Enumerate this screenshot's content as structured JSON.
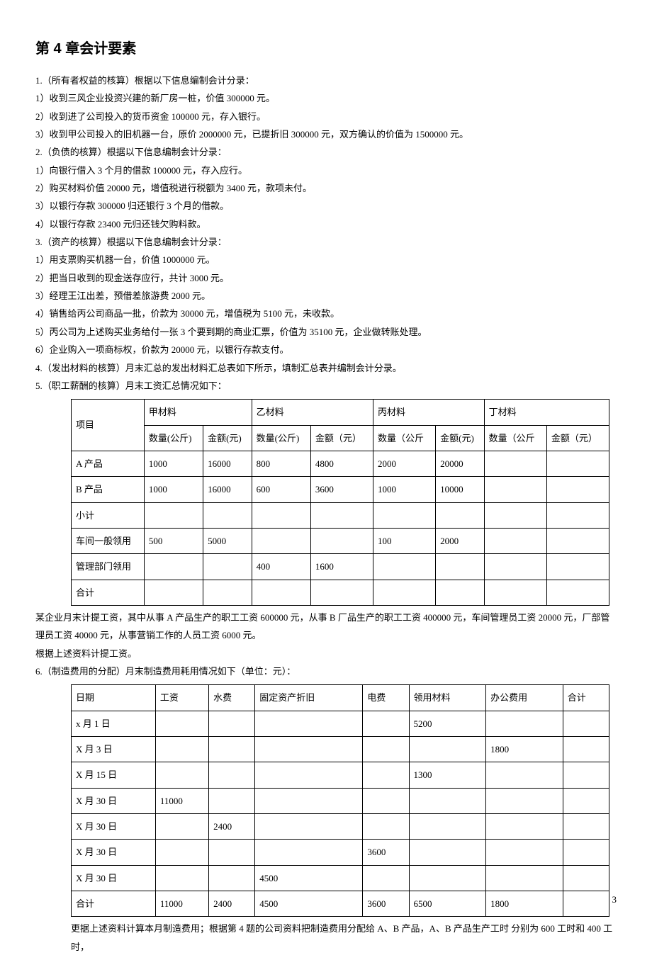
{
  "heading": "第 4 章会计要素",
  "paras": [
    "1.（所有者权益的核算）根据以下信息编制会计分录：",
    "1）收到三风企业投资兴建的新厂房一桩，价值 300000 元。",
    "2）收到进了公司投入的货币资金 100000 元，存入银行。",
    "3）收到甲公司投入的旧机器一台，原价 2000000 元，已提折旧 300000 元，双方确认的价值为 1500000 元。",
    "2.（负债的核算）根据以下信息编制会计分录：",
    "1）向银行借入 3 个月的借款 100000 元，存入应行。",
    "2）购买材料价值 20000 元，增值税进行税额为 3400 元，款项未付。",
    "3）以银行存款 300000 归还银行 3 个月的借款。",
    "4）以银行存款 23400 元归还钱欠购料款。",
    "3.（资产的核算）根据以下信息编制会计分录：",
    "1）用支票购买机器一台，价值 1000000 元。",
    "2）把当日收到的现金送存应行，共计 3000 元。",
    "3）经理王江出差，预借差旅游费 2000 元。",
    "4）销售给丙公司商品一批，价款为 30000 元，增值税为 5100 元，未收款。",
    "5）丙公司为上述购买业务给付一张 3 个要到期的商业汇票，价值为 35100 元，企业做转账处理。",
    "6）企业购入一项商标权，价款为 20000 元，以银行存款支付。",
    "4.（发出材料的核算）月末汇总的发出材料汇总表如下所示，填制汇总表并编制会计分录。",
    "5.（职工薪酬的核算）月末工资汇总情况如下："
  ],
  "table1": {
    "col_item": "项目",
    "groups": [
      "甲材料",
      "乙材料",
      "丙材料",
      "丁材料"
    ],
    "sub_qty": "数量(公斤)",
    "sub_qty_wide": "数量（公斤",
    "sub_amt": "金额(元)",
    "sub_amt_wide": "金额（元）",
    "rows": [
      {
        "label": "A 产品",
        "c": [
          "1000",
          "16000",
          "800",
          "4800",
          "2000",
          "20000",
          "",
          ""
        ]
      },
      {
        "label": "B 产品",
        "c": [
          "1000",
          "16000",
          "600",
          "3600",
          "1000",
          "10000",
          "",
          ""
        ]
      },
      {
        "label": "小计",
        "c": [
          "",
          "",
          "",
          "",
          "",
          "",
          "",
          ""
        ]
      },
      {
        "label": "车间一般领用",
        "c": [
          "500",
          "5000",
          "",
          "",
          "100",
          "2000",
          "",
          ""
        ]
      },
      {
        "label": "管理部门领用",
        "c": [
          "",
          "",
          "400",
          "1600",
          "",
          "",
          "",
          ""
        ]
      },
      {
        "label": "合计",
        "c": [
          "",
          "",
          "",
          "",
          "",
          "",
          "",
          ""
        ]
      }
    ]
  },
  "mid_paras": [
    "某企业月末计提工资，其中从事 A 产品生产的职工工资 600000 元，从事 B 厂品生产的职工工资 400000 元，车间管理员工资 20000 元，厂部管理员工资 40000 元，从事营销工作的人员工资 6000 元。",
    "根据上述资料计提工资。",
    "6.（制造费用的分配）月末制造费用耗用情况如下（单位：元）："
  ],
  "table2": {
    "headers": [
      "日期",
      "工资",
      "水费",
      "固定资产折旧",
      "电费",
      "领用材料",
      "办公费用",
      "合计"
    ],
    "rows": [
      {
        "c": [
          "x 月 1 日",
          "",
          "",
          "",
          "",
          "5200",
          "",
          ""
        ]
      },
      {
        "c": [
          "X 月 3 日",
          "",
          "",
          "",
          "",
          "",
          "1800",
          ""
        ]
      },
      {
        "c": [
          "X 月 15 日",
          "",
          "",
          "",
          "",
          "1300",
          "",
          ""
        ]
      },
      {
        "c": [
          "X 月 30 日",
          "11000",
          "",
          "",
          "",
          "",
          "",
          ""
        ]
      },
      {
        "c": [
          "X 月 30 日",
          "",
          "2400",
          "",
          "",
          "",
          "",
          ""
        ]
      },
      {
        "c": [
          "X 月 30 日",
          "",
          "",
          "",
          "3600",
          "",
          "",
          ""
        ]
      },
      {
        "c": [
          "X 月 30 日",
          "",
          "",
          "4500",
          "",
          "",
          "",
          ""
        ]
      },
      {
        "c": [
          "合计",
          "11000",
          "2400",
          "4500",
          "3600",
          "6500",
          "1800",
          ""
        ]
      }
    ]
  },
  "tail_para": "更据上述资料计算本月制造费用；根据第 4 题的公司资料把制造费用分配给 A、B 产品，A、B 产品生产工时 分别为 600 工时和 400 工时，",
  "page_number": "3"
}
